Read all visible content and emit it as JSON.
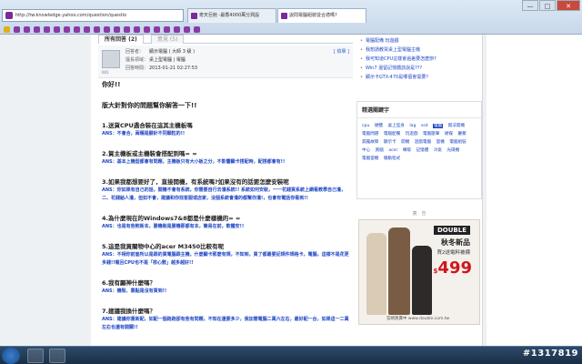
{
  "browser": {
    "url": "http://tw.knowledge.yahoo.com/question/questio",
    "tabs": [
      {
        "label": "奇摩知識+"
      },
      {
        "label": "奇天巨館 -最香4000萬分潤設"
      },
      {
        "label": "說問電腦組裝從合適嗎?"
      }
    ],
    "window_buttons": [
      "—",
      "□",
      "✕"
    ],
    "colors": {
      "yahoo": "#7b2a97",
      "answer_blue": "#1f47c5"
    }
  },
  "answer_tabs": {
    "all": "所有回答 (2)",
    "other": "意見 (5)"
  },
  "meta": {
    "rows": [
      {
        "k": "回答者：",
        "v": "顯示電腦 ( 大師 3 級 )"
      },
      {
        "k": "擅長領域：",
        "v": "桌上型電腦 | 電腦"
      },
      {
        "k": "回答時間：",
        "v": "2013-01-21 02:27:53"
      }
    ],
    "report": "[ 檢舉 ]",
    "avatar_caption": "001"
  },
  "post": {
    "greeting": "你好!!",
    "intro": "版大針對你的問題幫你解答一下!!",
    "qa": [
      {
        "q": "1.送貨CPU遇合裝在這其主機板嗎",
        "a": "ANS：不會合，兩種是腳針不同顆粒的!!"
      },
      {
        "q": "2.賀主機板或主機裝會搭配到嗎= =",
        "a": "ANS：基本上機型都會有問題，主機板只有大小板之分，不影響顯卡搭配時，配搭都會有!!"
      },
      {
        "q": "3.如果我都想要好了，直接開機，有系統嗎?如果沒有的話要怎麼安裝呢",
        "a": "ANS：你如果有自己的話，開機不會有系統，你需要自行去灌系統!! 系統如何安裝，一一花錢買系統上網看教學自己灌，二、花錢給人灌，但如不會，建議和你找客服或店家，沒個系統會灌的都幫你灌!，也會有電話你看到!!"
      },
      {
        "q": "4.為什麼現在的Windows7&8都是什麼樣機的= =",
        "a": "ANS：也是有些較新本，勝機裝是勝機那都有本，簡易在前，軟體安!!"
      },
      {
        "q": "5.這是我買關物中心的acer M3450比較有呢",
        "a": "ANS：不相你前面所以是跟的買電腦跟主機，什麼顯卡那麼有規，不知到，買了都最要記規件規格卡，電腦，這樣不是花更多錢!!喔且CPU也不是「核心數」越多越好!!"
      },
      {
        "q": "6.我有顯神什麼嗎？",
        "a": "ANS：機殼、靠點是沒有買到!!"
      },
      {
        "q": "7.建議我換什麼嗎？",
        "a": "ANS：建議你重新配，如配一個跑跑卻有些有問題，不知在還要多少，我加需電腦二萬六左右，最好配一台，如果這一二萬左右也還有開關!!"
      }
    ]
  },
  "sidebar": {
    "links": [
      "電腦配備 玩遊戲",
      "我想請教買桌上型電腦主機",
      "我可知道CPU這樣會過差要怎麼辦?",
      "Win7 還留記憶體該說是???",
      "顯示卡GTX-470是哪個會需要?"
    ],
    "keywords_title": "精選關鍵字",
    "keywords": [
      "cpu",
      "硬體",
      "桌上型身",
      "lag",
      "ssd",
      "電腦",
      "無法開機",
      "電腦問題",
      "電腦配備",
      "玩遊戲",
      "電腦壓筆",
      "硬碟",
      "慶聚",
      "漏露故障",
      "顯示卡",
      "開機",
      "遊戲電腦",
      "當機",
      "電腦組裝",
      "中心",
      "買腦",
      "acer",
      "轉取",
      "記憶體",
      "冷氣",
      "光碟機",
      "電腦當機",
      "驅動程式"
    ],
    "keywords_highlight": "電腦",
    "ad_label": "廣　告",
    "ad": {
      "brand": "DOUBLE",
      "title": "秋冬新品",
      "subtitle": "買2送電料被襪",
      "price": "499",
      "currency": "$",
      "url": "官網買賣中 www.double.com.tw"
    }
  },
  "watermark": "#1317819"
}
